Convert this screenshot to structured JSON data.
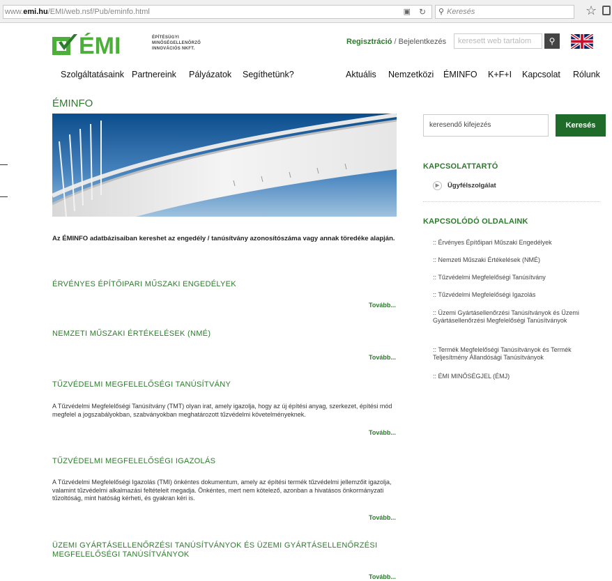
{
  "browser": {
    "url_prefix": "www.",
    "url_domain": "emi.hu",
    "url_path": "/EMI/web.nsf/Pub/eminfo.html",
    "search_placeholder": "Keresés"
  },
  "header": {
    "logo_text": "ÉMI",
    "logo_line1": "ÉPÍTÉSÜGYI",
    "logo_line2": "MINŐSÉGELLENŐRZŐ",
    "logo_line3": "INNOVÁCIÓS NKFT.",
    "register": "Regisztráció",
    "separator": "/",
    "login": "Bejelentkezés",
    "search_placeholder": "keresett web tartalom"
  },
  "nav_left": [
    "Szolgáltatásaink",
    "Partnereink",
    "Pályázatok",
    "Segíthetünk?"
  ],
  "nav_right": [
    "Aktuális",
    "Nemzetközi",
    "ÉMINFO",
    "K+F+I",
    "Kapcsolat",
    "Rólunk"
  ],
  "main": {
    "title": "ÉMINFO",
    "intro": "Az ÉMINFO adatbázisaiban kereshet az engedély / tanúsítvány azonosítószáma vagy annak töredéke alapján.",
    "more_label": "Tovább...",
    "sections": [
      {
        "title": "ÉRVÉNYES ÉPÍTŐIPARI MŰSZAKI ENGEDÉLYEK",
        "text": ""
      },
      {
        "title": "NEMZETI MŰSZAKI ÉRTÉKELÉSEK (NMÉ)",
        "text": ""
      },
      {
        "title": "TŰZVÉDELMI MEGFELELŐSÉGI TANÚSÍTVÁNY",
        "text": "A Tűzvédelmi Megfelelőségi Tanúsítvány (TMT) olyan irat, amely igazolja, hogy az új építési anyag, szerkezet, építési mód megfelel a jogszabályokban, szabványokban meghatározott tűzvédelmi követelményeknek."
      },
      {
        "title": "TŰZVÉDELMI MEGFELELŐSÉGI IGAZOLÁS",
        "text": "A Tűzvédelmi Megfelelőségi Igazolás (TMI) önkéntes dokumentum, amely az építési termék tűzvédelmi jellemzőit igazolja, valamint tűzvédelmi alkalmazási feltételeit megadja. Önkéntes, mert nem kötelező, azonban a hivatásos önkormányzati tűzoltóság, mint hatóság kérheti, és gyakran kéri is."
      },
      {
        "title": "ÜZEMI GYÁRTÁSELLENŐRZÉSI TANÚSÍTVÁNYOK ÉS ÜZEMI GYÁRTÁSELLENŐRZÉSI MEGFELELŐSÉGI TANÚSÍTVÁNYOK",
        "text": ""
      }
    ]
  },
  "sidebar": {
    "search_placeholder": "keresendő kifejezés",
    "search_button": "Keresés",
    "contact_title": "KAPCSOLATTARTÓ",
    "contact_link": "Ügyfélszolgálat",
    "related_title": "KAPCSOLÓDÓ OLDALAINK",
    "related_links": [
      ":: Érvényes Építőipari Műszaki Engedélyek",
      ":: Nemzeti Műszaki Értékelések (NMÉ)",
      ":: Tűzvédelmi Megfelelőségi Tanúsítvány",
      ":: Tűzvédelmi Megfelelőségi Igazolás",
      ":: Üzemi Gyártásellenőrzési Tanúsítványok és Üzemi Gyártásellenőrzési Megfelelőségi Tanúsítványok",
      ":: Termék Megfelelőségi Tanúsítványok és Termék Teljesítmény Állandósági Tanúsítványok",
      ":: ÉMI MINŐSÉGJEL (ÉMJ)"
    ]
  },
  "colors": {
    "brand_green": "#2d7a2d",
    "button_green": "#1f6b2a"
  }
}
